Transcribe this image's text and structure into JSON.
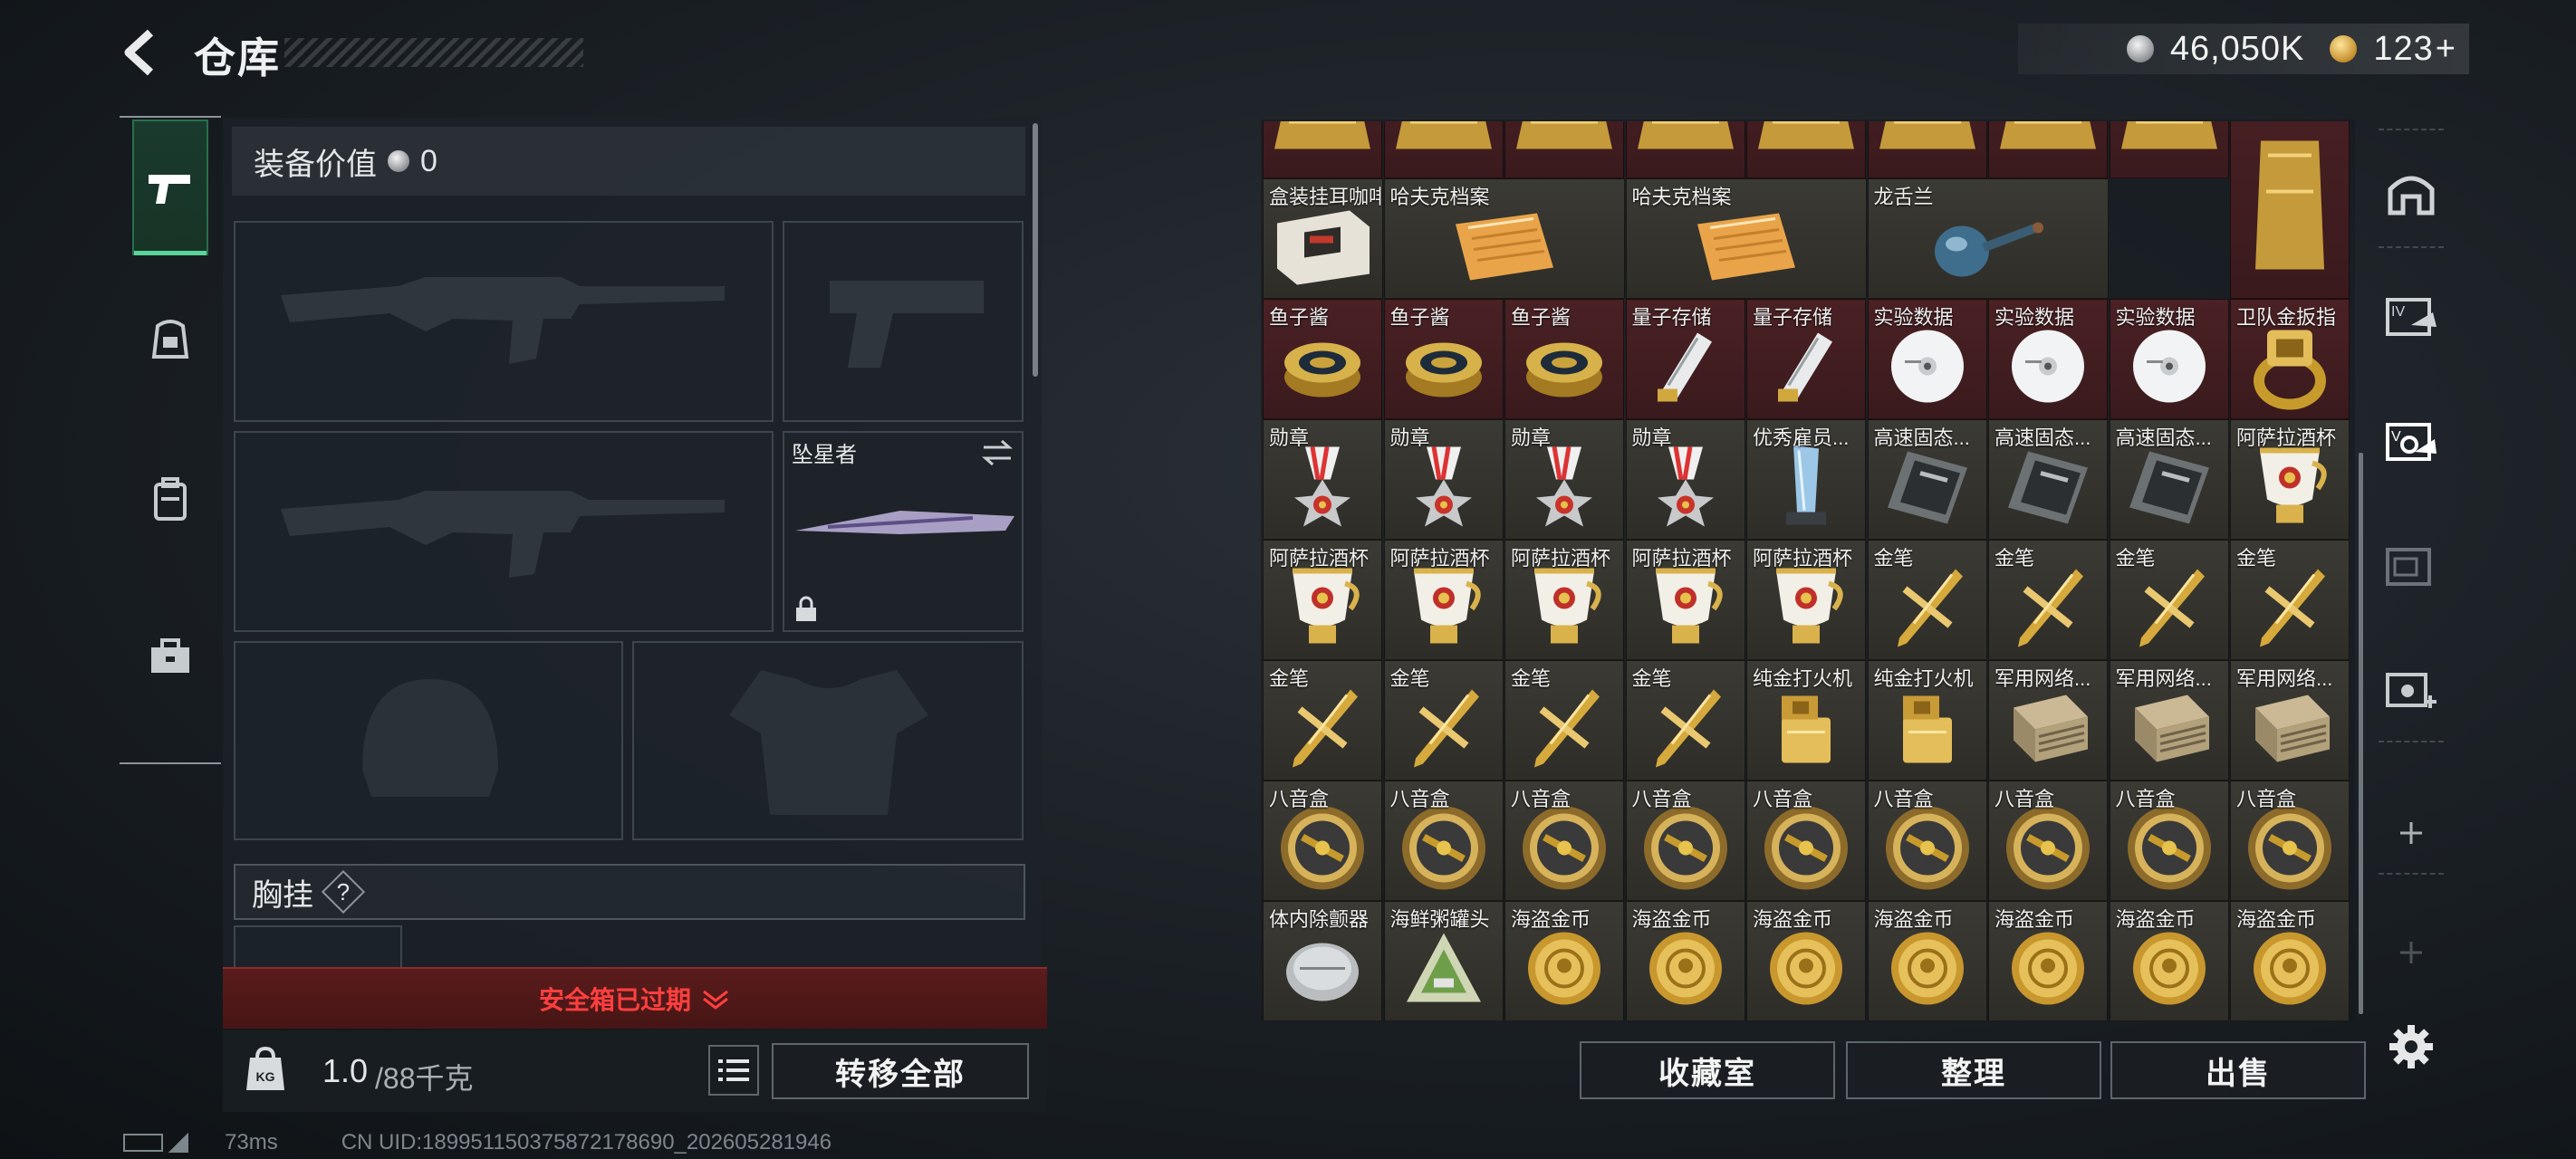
{
  "header": {
    "title": "仓库",
    "silver_amount": "46,050K",
    "gold_amount": "123",
    "gold_plus": "+"
  },
  "left_nav": [
    {
      "icon": "pistol-icon",
      "active": true
    },
    {
      "icon": "helmet-rig-icon",
      "active": false
    },
    {
      "icon": "backpack-icon",
      "active": false
    },
    {
      "icon": "toolbox-icon",
      "active": false
    }
  ],
  "loadout": {
    "value_label": "装备价值",
    "value_amount": "0",
    "melee_name": "坠星者",
    "chest_rig_label": "胸挂",
    "chest_rig_help": "?",
    "safe_box_status": "安全箱已过期"
  },
  "bottom_left": {
    "weight_current": "1.0",
    "weight_max": "/88千克",
    "weight_unit_icon": "KG",
    "transfer_all_label": "转移全部"
  },
  "status_bar": {
    "ping": "73ms",
    "uid": "CN UID:1899511503758721786​90_202605281946"
  },
  "stash_rows": [
    {
      "row": 0,
      "items": [
        {
          "name": "",
          "icon": "gold-bar",
          "bg": "red"
        },
        {
          "name": "",
          "icon": "gold-bar",
          "bg": "red"
        },
        {
          "name": "",
          "icon": "gold-bar",
          "bg": "red"
        },
        {
          "name": "",
          "icon": "gold-bar",
          "bg": "red"
        },
        {
          "name": "",
          "icon": "gold-bar",
          "bg": "red"
        },
        {
          "name": "",
          "icon": "gold-bar",
          "bg": "red"
        },
        {
          "name": "",
          "icon": "gold-bar",
          "bg": "red"
        },
        {
          "name": "",
          "icon": "gold-bar",
          "bg": "red"
        }
      ]
    },
    {
      "row": 1,
      "items": [
        {
          "name": "盒装挂耳咖啡",
          "icon": "coffee-box",
          "bg": "gray"
        },
        {
          "name": "哈夫克档案",
          "icon": "document",
          "bg": "gray"
        },
        {
          "name": "哈夫克档案",
          "icon": "document",
          "bg": "gray"
        },
        {
          "name": "龙舌兰",
          "icon": "tequila-bottle",
          "bg": "gray"
        }
      ]
    },
    {
      "row": 2,
      "items": [
        {
          "name": "鱼子酱",
          "icon": "caviar-tin",
          "bg": "red"
        },
        {
          "name": "鱼子酱",
          "icon": "caviar-tin",
          "bg": "red"
        },
        {
          "name": "鱼子酱",
          "icon": "caviar-tin",
          "bg": "red"
        },
        {
          "name": "量子存储",
          "icon": "quantum-storage",
          "bg": "red"
        },
        {
          "name": "量子存储",
          "icon": "quantum-storage",
          "bg": "red"
        },
        {
          "name": "实验数据",
          "icon": "data-disc",
          "bg": "red"
        },
        {
          "name": "实验数据",
          "icon": "data-disc",
          "bg": "red"
        },
        {
          "name": "实验数据",
          "icon": "data-disc",
          "bg": "red"
        },
        {
          "name": "卫队金扳指",
          "icon": "gold-ring",
          "bg": "red"
        }
      ]
    },
    {
      "row": 3,
      "items": [
        {
          "name": "勋章",
          "icon": "medal",
          "bg": "gray"
        },
        {
          "name": "勋章",
          "icon": "medal",
          "bg": "gray"
        },
        {
          "name": "勋章",
          "icon": "medal",
          "bg": "gray"
        },
        {
          "name": "勋章",
          "icon": "medal",
          "bg": "gray"
        },
        {
          "name": "优秀雇员...",
          "icon": "crystal-trophy",
          "bg": "gray"
        },
        {
          "name": "高速固态...",
          "icon": "ssd-drive",
          "bg": "gray"
        },
        {
          "name": "高速固态...",
          "icon": "ssd-drive",
          "bg": "gray"
        },
        {
          "name": "高速固态...",
          "icon": "ssd-drive",
          "bg": "gray"
        },
        {
          "name": "阿萨拉酒杯",
          "icon": "goblet",
          "bg": "gray"
        }
      ]
    },
    {
      "row": 4,
      "items": [
        {
          "name": "阿萨拉酒杯",
          "icon": "goblet",
          "bg": "gray"
        },
        {
          "name": "阿萨拉酒杯",
          "icon": "goblet",
          "bg": "gray"
        },
        {
          "name": "阿萨拉酒杯",
          "icon": "goblet",
          "bg": "gray"
        },
        {
          "name": "阿萨拉酒杯",
          "icon": "goblet",
          "bg": "gray"
        },
        {
          "name": "阿萨拉酒杯",
          "icon": "goblet",
          "bg": "gray"
        },
        {
          "name": "金笔",
          "icon": "gold-pen",
          "bg": "gray"
        },
        {
          "name": "金笔",
          "icon": "gold-pen",
          "bg": "gray"
        },
        {
          "name": "金笔",
          "icon": "gold-pen",
          "bg": "gray"
        },
        {
          "name": "金笔",
          "icon": "gold-pen",
          "bg": "gray"
        }
      ]
    },
    {
      "row": 5,
      "items": [
        {
          "name": "金笔",
          "icon": "gold-pen",
          "bg": "gray"
        },
        {
          "name": "金笔",
          "icon": "gold-pen",
          "bg": "gray"
        },
        {
          "name": "金笔",
          "icon": "gold-pen",
          "bg": "gray"
        },
        {
          "name": "金笔",
          "icon": "gold-pen",
          "bg": "gray"
        },
        {
          "name": "纯金打火机",
          "icon": "gold-lighter",
          "bg": "gray"
        },
        {
          "name": "纯金打火机",
          "icon": "gold-lighter",
          "bg": "gray"
        },
        {
          "name": "军用网络...",
          "icon": "network-module",
          "bg": "gray"
        },
        {
          "name": "军用网络...",
          "icon": "network-module",
          "bg": "gray"
        },
        {
          "name": "军用网络...",
          "icon": "network-module",
          "bg": "gray"
        }
      ]
    },
    {
      "row": 6,
      "items": [
        {
          "name": "八音盒",
          "icon": "music-box",
          "bg": "gray"
        },
        {
          "name": "八音盒",
          "icon": "music-box",
          "bg": "gray"
        },
        {
          "name": "八音盒",
          "icon": "music-box",
          "bg": "gray"
        },
        {
          "name": "八音盒",
          "icon": "music-box",
          "bg": "gray"
        },
        {
          "name": "八音盒",
          "icon": "music-box",
          "bg": "gray"
        },
        {
          "name": "八音盒",
          "icon": "music-box",
          "bg": "gray"
        },
        {
          "name": "八音盒",
          "icon": "music-box",
          "bg": "gray"
        },
        {
          "name": "八音盒",
          "icon": "music-box",
          "bg": "gray"
        },
        {
          "name": "八音盒",
          "icon": "music-box",
          "bg": "gray"
        }
      ]
    },
    {
      "row": 7,
      "items": [
        {
          "name": "体内除颤器",
          "icon": "defibrillator",
          "bg": "gray"
        },
        {
          "name": "海鲜粥罐头",
          "icon": "porridge-can",
          "bg": "gray"
        },
        {
          "name": "海盗金币",
          "icon": "pirate-coin",
          "bg": "gray"
        },
        {
          "name": "海盗金币",
          "icon": "pirate-coin",
          "bg": "gray"
        },
        {
          "name": "海盗金币",
          "icon": "pirate-coin",
          "bg": "gray"
        },
        {
          "name": "海盗金币",
          "icon": "pirate-coin",
          "bg": "gray"
        },
        {
          "name": "海盗金币",
          "icon": "pirate-coin",
          "bg": "gray"
        },
        {
          "name": "海盗金币",
          "icon": "pirate-coin",
          "bg": "gray"
        },
        {
          "name": "海盗金币",
          "icon": "pirate-coin",
          "bg": "gray"
        }
      ]
    }
  ],
  "stash_actions": {
    "collection_label": "收藏室",
    "sort_label": "整理",
    "sell_label": "出售"
  },
  "right_nav": [
    {
      "icon": "safe-house-icon"
    },
    {
      "icon": "stash-1-icon"
    },
    {
      "icon": "stash-2-icon"
    },
    {
      "icon": "stash-3-icon"
    },
    {
      "icon": "stash-add-icon"
    },
    {
      "icon": "plus-icon"
    },
    {
      "icon": "plus-icon"
    },
    {
      "icon": "settings-gear-icon"
    }
  ]
}
